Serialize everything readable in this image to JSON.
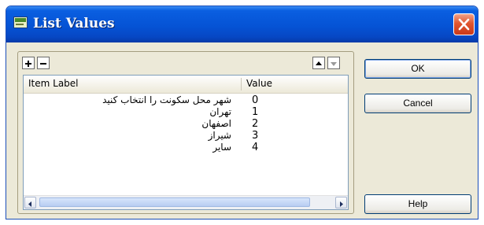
{
  "window": {
    "title": "List Values"
  },
  "toolbar": {
    "add_icon": "plus-icon",
    "remove_icon": "minus-icon",
    "move_up_icon": "arrow-up-icon",
    "move_down_icon": "arrow-down-icon"
  },
  "list": {
    "columns": [
      "Item Label",
      "Value"
    ],
    "rows": [
      {
        "label": "شهر محل سکونت را انتخاب کنید",
        "value": "0"
      },
      {
        "label": "تهران",
        "value": "1"
      },
      {
        "label": "اصفهان",
        "value": "2"
      },
      {
        "label": "شیراز",
        "value": "3"
      },
      {
        "label": "سایر",
        "value": "4"
      }
    ]
  },
  "buttons": {
    "ok": "OK",
    "cancel": "Cancel",
    "help": "Help"
  },
  "colors": {
    "titlebar": "#0553d5",
    "face": "#ece9d8",
    "close": "#e0562f"
  }
}
